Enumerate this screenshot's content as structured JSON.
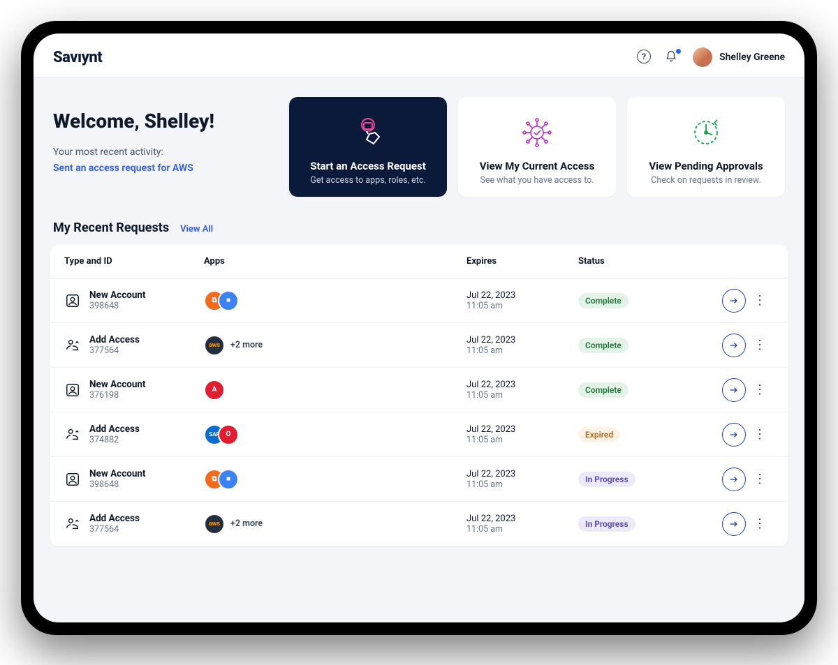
{
  "brand": "Savıynt",
  "user": {
    "name": "Shelley Greene"
  },
  "welcome": {
    "title": "Welcome, Shelley!",
    "activity_label": "Your most recent activity:",
    "activity_link": "Sent an access request for AWS"
  },
  "cards": [
    {
      "title": "Start an Access Request",
      "sub": "Get access to apps, roles, etc."
    },
    {
      "title": "View My Current Access",
      "sub": "See what you have access to."
    },
    {
      "title": "View Pending Approvals",
      "sub": "Check on requests in review."
    }
  ],
  "requests_section": {
    "title": "My Recent Requests",
    "view_all": "View All"
  },
  "columns": {
    "type": "Type and ID",
    "apps": "Apps",
    "expires": "Expires",
    "status": "Status"
  },
  "status_labels": {
    "complete": "Complete",
    "expired": "Expired",
    "inprogress": "In Progress"
  },
  "app_icons": {
    "orange_copy": {
      "bg": "#f26a1b",
      "label": "⧉"
    },
    "blue_video": {
      "bg": "#3b82f6",
      "label": "■"
    },
    "aws": {
      "bg": "#232f3e",
      "label": "aws"
    },
    "adp": {
      "bg": "#e11d30",
      "label": "A"
    },
    "sap": {
      "bg": "#0a6ed1",
      "label": "SAP"
    },
    "oracle": {
      "bg": "#e11d30",
      "label": "O"
    }
  },
  "rows": [
    {
      "type": "New Account",
      "id": "398648",
      "apps": [
        "orange_copy",
        "blue_video"
      ],
      "more": "",
      "date": "Jul 22, 2023",
      "time": "11:05 am",
      "status": "complete"
    },
    {
      "type": "Add Access",
      "id": "377564",
      "apps": [
        "aws"
      ],
      "more": "+2 more",
      "date": "Jul 22, 2023",
      "time": "11:05 am",
      "status": "complete"
    },
    {
      "type": "New Account",
      "id": "376198",
      "apps": [
        "adp"
      ],
      "more": "",
      "date": "Jul 22, 2023",
      "time": "11:05 am",
      "status": "complete"
    },
    {
      "type": "Add Access",
      "id": "374882",
      "apps": [
        "sap",
        "oracle"
      ],
      "more": "",
      "date": "Jul 22, 2023",
      "time": "11:05 am",
      "status": "expired"
    },
    {
      "type": "New Account",
      "id": "398648",
      "apps": [
        "orange_copy",
        "blue_video"
      ],
      "more": "",
      "date": "Jul 22, 2023",
      "time": "11:05 am",
      "status": "inprogress"
    },
    {
      "type": "Add Access",
      "id": "377564",
      "apps": [
        "aws"
      ],
      "more": "+2 more",
      "date": "Jul 22, 2023",
      "time": "11:05 am",
      "status": "inprogress"
    }
  ]
}
